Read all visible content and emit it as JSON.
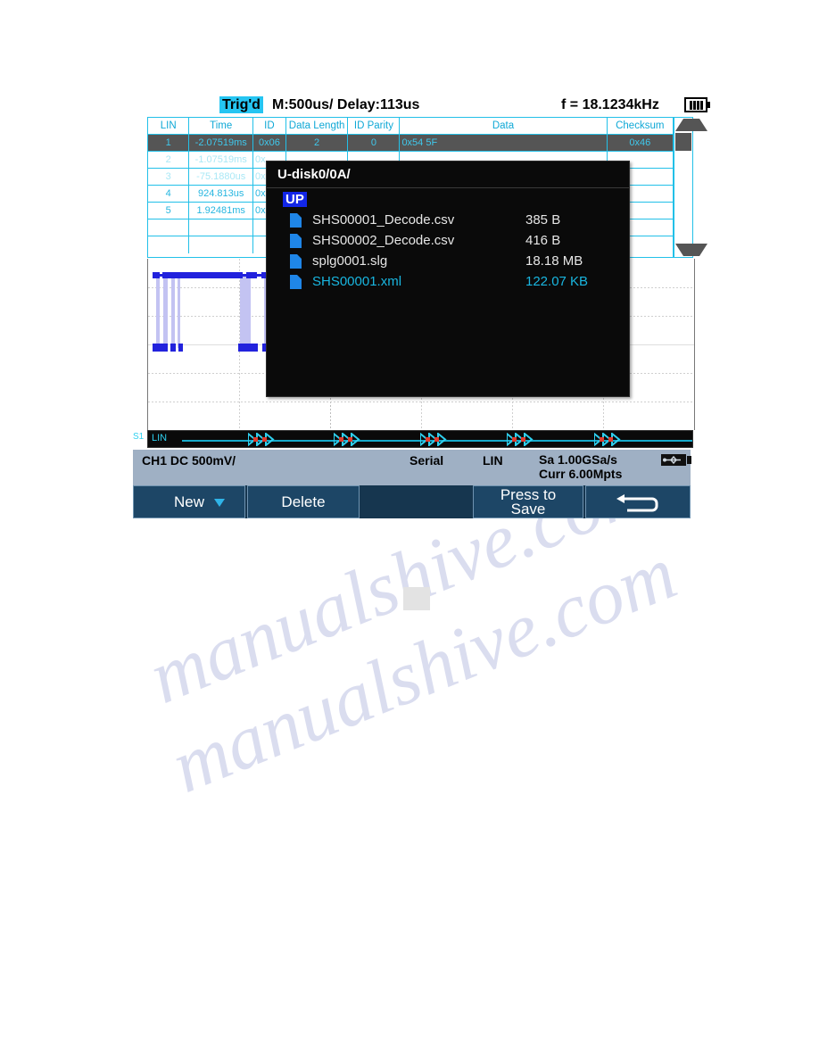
{
  "topbar": {
    "trigger_status": "Trig'd",
    "timebase": "M:500us/ Delay:113us",
    "frequency": "f = 18.1234kHz",
    "battery_icon": "battery-full-icon"
  },
  "decode_table": {
    "columns": [
      "LIN",
      "Time",
      "ID",
      "Data Length",
      "ID Parity",
      "Data",
      "Checksum"
    ],
    "rows": [
      {
        "lin": "1",
        "time": "-2.07519ms",
        "id": "0x06",
        "data_length": "2",
        "id_parity": "0",
        "data": "0x54 5F",
        "checksum": "0x46",
        "selected": true
      },
      {
        "lin": "2",
        "time": "-1.07519ms",
        "id": "0x",
        "data_length": "",
        "id_parity": "",
        "data": "",
        "checksum": "",
        "selected": false
      },
      {
        "lin": "3",
        "time": "-75.1880us",
        "id": "0x",
        "data_length": "",
        "id_parity": "",
        "data": "",
        "checksum": "",
        "selected": false
      },
      {
        "lin": "4",
        "time": "924.813us",
        "id": "0x",
        "data_length": "",
        "id_parity": "",
        "data": "",
        "checksum": "",
        "selected": false
      },
      {
        "lin": "5",
        "time": "1.92481ms",
        "id": "0x",
        "data_length": "",
        "id_parity": "",
        "data": "",
        "checksum": "",
        "selected": false
      },
      {
        "lin": "",
        "time": "",
        "id": "",
        "data_length": "",
        "id_parity": "",
        "data": "",
        "checksum": "",
        "selected": false
      },
      {
        "lin": "",
        "time": "",
        "id": "",
        "data_length": "",
        "id_parity": "",
        "data": "",
        "checksum": "",
        "selected": false
      }
    ],
    "scrollbar": {
      "up_icon": "triangle-up-icon",
      "down_icon": "triangle-down-icon"
    },
    "sort_marker_icon": "triangle-down-icon"
  },
  "waveform": {
    "decode_bus_label": "LIN",
    "channel_marker": "S1"
  },
  "file_dialog": {
    "path": "U-disk0/0A/",
    "up_label": "UP",
    "size_header": "",
    "files": [
      {
        "name": "SHS00001_Decode.csv",
        "size": "385 B",
        "selected": false
      },
      {
        "name": "SHS00002_Decode.csv",
        "size": "416 B",
        "selected": false
      },
      {
        "name": "splg0001.slg",
        "size": "18.18 MB",
        "selected": false
      },
      {
        "name": "SHS00001.xml",
        "size": "122.07 KB",
        "selected": true
      }
    ]
  },
  "info_bar": {
    "channel": "CH1 DC 500mV/",
    "mode": "Serial",
    "protocol": "LIN",
    "sample_rate": "Sa 1.00GSa/s",
    "memory_depth": "Curr 6.00Mpts",
    "usb_icon": "usb-icon"
  },
  "softkeys": [
    {
      "label": "New",
      "has_dropdown": true
    },
    {
      "label": "Delete",
      "has_dropdown": false
    },
    {
      "label": "",
      "has_dropdown": false
    },
    {
      "label": "Press to\nSave",
      "has_dropdown": false
    },
    {
      "label": "",
      "icon": "back-arrow-icon",
      "has_dropdown": false
    }
  ],
  "watermark": {
    "line1": "manualshive.com",
    "line2": "manualshive.com"
  },
  "colors": {
    "accent_cyan": "#22c0e8",
    "trig_highlight": "#25c5f2",
    "selected_blue": "#1226e8",
    "file_selected": "#19b6e0",
    "signal_blue": "#2222dd",
    "infobar_bg": "#9fb0c4",
    "softkey_bg": "#1d4666"
  }
}
